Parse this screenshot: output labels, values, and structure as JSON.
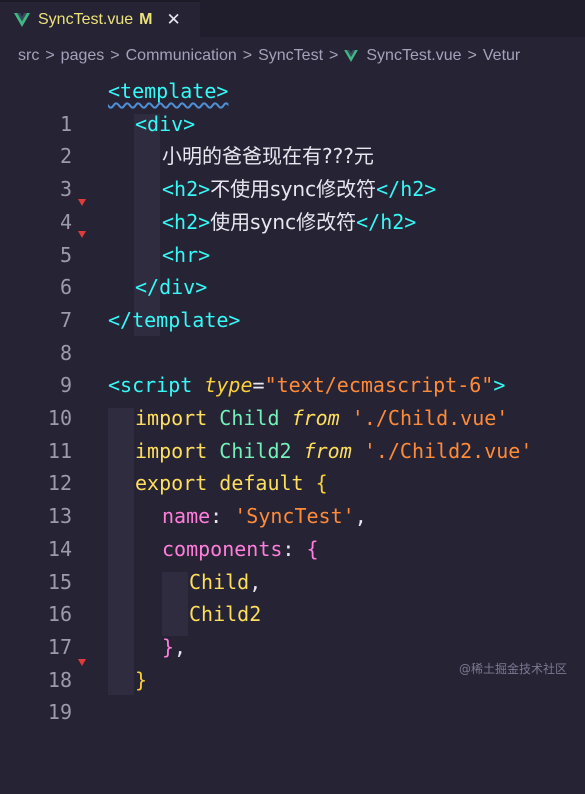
{
  "tab": {
    "filename": "SyncTest.vue",
    "status": "M",
    "close_glyph": "✕"
  },
  "breadcrumb": [
    "src",
    "pages",
    "Communication",
    "SyncTest",
    "SyncTest.vue",
    "Vetur"
  ],
  "breadcrumb_sep": ">",
  "line_numbers": [
    "1",
    "2",
    "3",
    "4",
    "5",
    "6",
    "7",
    "8",
    "9",
    "10",
    "11",
    "12",
    "13",
    "14",
    "15",
    "16",
    "17",
    "18",
    "19"
  ],
  "code": {
    "l1": "<template>",
    "l2_open": "<div>",
    "l3": "小明的爸爸现在有???元",
    "l4_open": "<h2>",
    "l4_text": "不使用sync修改符",
    "l4_close": "</h2>",
    "l5_open": "<h2>",
    "l5_text": "使用sync修改符",
    "l5_close": "</h2>",
    "l6": "<hr>",
    "l7": "</div>",
    "l8": "</template>",
    "l10_tag": "<script",
    "l10_attr": "type",
    "l10_eq": "=",
    "l10_val": "\"text/ecmascript-6\"",
    "l10_end": ">",
    "l11_kw": "import",
    "l11_id": "Child",
    "l11_from": "from",
    "l11_str": "'./Child.vue'",
    "l12_kw": "import",
    "l12_id": "Child2",
    "l12_from": "from",
    "l12_str": "'./Child2.vue'",
    "l13_kw": "export default",
    "l13_brace": "{",
    "l14_key": "name",
    "l14_colon": ":",
    "l14_str": "'SyncTest'",
    "l14_comma": ",",
    "l15_key": "components",
    "l15_colon": ":",
    "l15_brace": "{",
    "l16": "Child",
    "l16_comma": ",",
    "l17": "Child2",
    "l18_brace": "}",
    "l18_comma": ",",
    "l19_brace": "}"
  },
  "watermark": "@稀土掘金技术社区",
  "colors": {
    "background": "#262335",
    "tag": "#36f9f6",
    "string": "#ff8b39",
    "keyword": "#fede5d",
    "accent_yellow": "#ece27a",
    "vue_green": "#41b883"
  }
}
